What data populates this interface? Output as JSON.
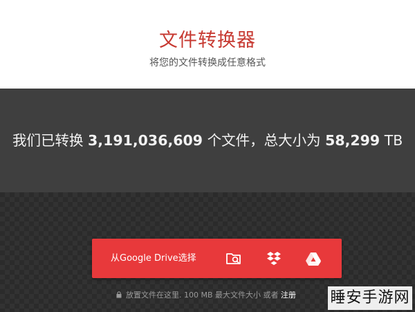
{
  "header": {
    "title": "文件转换器",
    "subtitle": "将您的文件转换成任意格式"
  },
  "stats": {
    "prefix": "我们已转换 ",
    "files_converted": "3,191,036,609",
    "middle": " 个文件，总大小为 ",
    "total_size": "58,299",
    "suffix": " TB"
  },
  "upload": {
    "gdrive_label": "从Google Drive选择",
    "icons": [
      "folder-search-icon",
      "dropbox-icon",
      "google-drive-icon"
    ]
  },
  "footer_note": {
    "text": "放置文件在这里. 100 MB 最大文件大小 或者 ",
    "signup_link": "注册"
  },
  "watermark": {
    "text": "睡安手游网"
  },
  "colors": {
    "accent": "#c73a32",
    "upload_bar": "#e8393b",
    "stats_bg": "#3f3f3f"
  }
}
